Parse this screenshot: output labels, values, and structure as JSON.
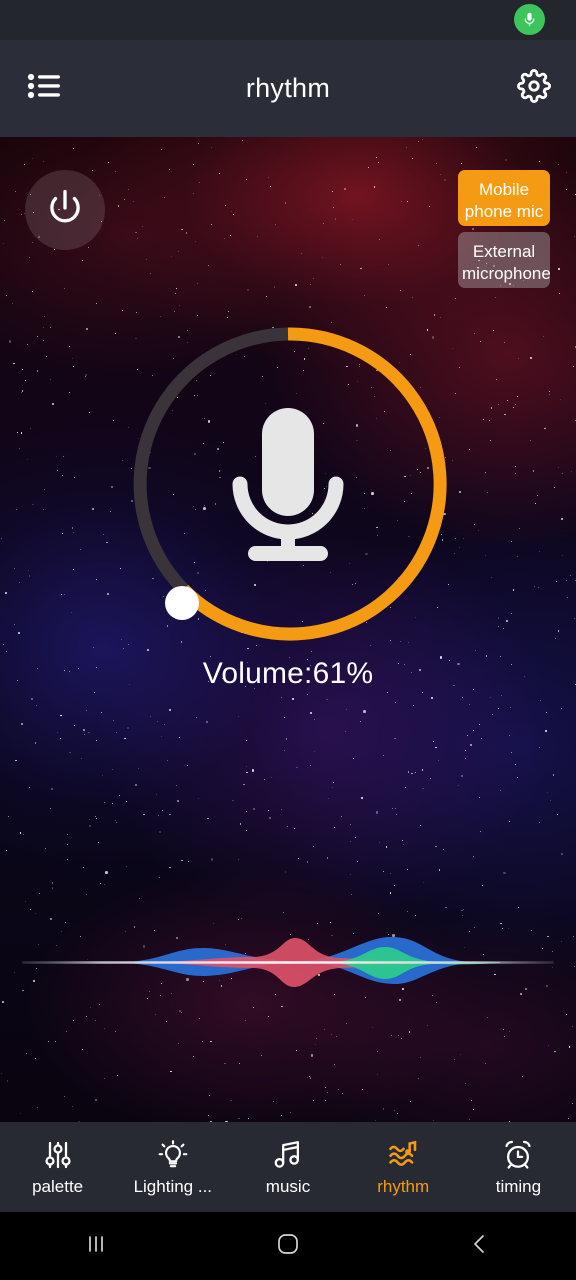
{
  "statusbar": {
    "mic_indicator_icon": "microphone-icon",
    "mic_indicator_color": "#3ec45c"
  },
  "appbar": {
    "title": "rhythm",
    "menu_icon": "list-icon",
    "settings_icon": "gear-icon",
    "background_color": "#2b2e38"
  },
  "main": {
    "power_icon": "power-icon",
    "mic_sources": [
      {
        "label": "Mobile phone mic",
        "active": true,
        "color": "#f59b13"
      },
      {
        "label": "External microphone",
        "active": false,
        "color": "#b6b0b2"
      }
    ],
    "volume": {
      "label": "Volume:61%",
      "percent": 61,
      "arc_color": "#f59b13",
      "track_color": "#3a343a",
      "knob_color": "#ffffff",
      "center_icon": "microphone-icon"
    },
    "waveform": {
      "icon": "audio-waveform",
      "colors": [
        "#2a6fd6",
        "#e0526a",
        "#2ecc8f"
      ],
      "baseline_color": "#d8d8e0"
    }
  },
  "tabbar": {
    "active_color": "#f59b13",
    "items": [
      {
        "label": "palette",
        "icon": "sliders-icon",
        "active": false
      },
      {
        "label": "Lighting ...",
        "icon": "lightbulb-icon",
        "active": false
      },
      {
        "label": "music",
        "icon": "music-note-icon",
        "active": false
      },
      {
        "label": "rhythm",
        "icon": "rhythm-wave-icon",
        "active": true
      },
      {
        "label": "timing",
        "icon": "alarm-clock-icon",
        "active": false
      }
    ]
  },
  "navbar": {
    "items": [
      {
        "name": "recents",
        "icon": "recents-icon"
      },
      {
        "name": "home",
        "icon": "home-icon"
      },
      {
        "name": "back",
        "icon": "back-icon"
      }
    ]
  }
}
